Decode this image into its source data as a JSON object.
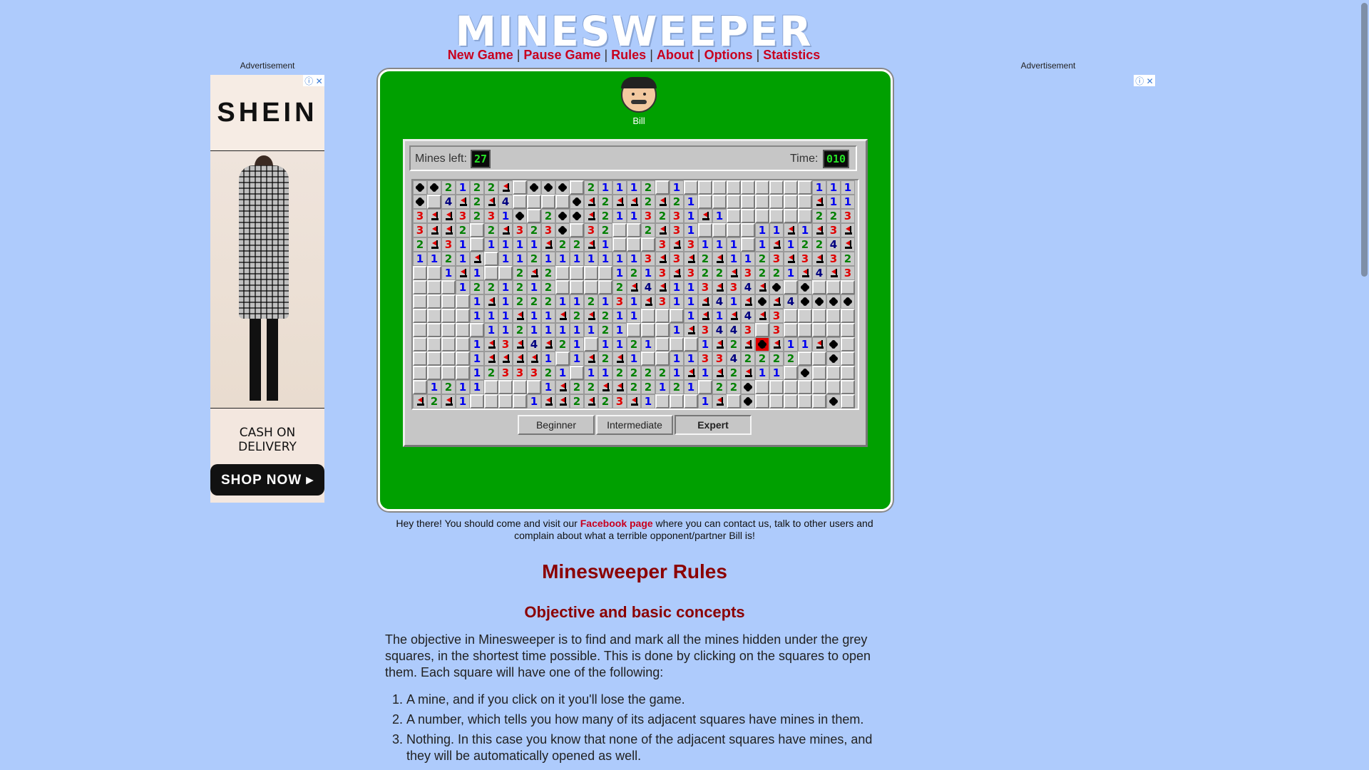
{
  "header": {
    "logo": "MINESWEEPER",
    "nav": [
      "New Game",
      "Pause Game",
      "Rules",
      "About",
      "Options",
      "Statistics"
    ]
  },
  "ads": {
    "left_label": "Advertisement",
    "right_label": "Advertisement",
    "left": {
      "brand": "SHEIN",
      "tagline": "CASH ON DELIVERY",
      "cta": "SHOP NOW ▸"
    }
  },
  "game": {
    "opponent": "Bill",
    "mines_left_label": "Mines left:",
    "mines_left": "27",
    "time_label": "Time:",
    "time": "010",
    "levels": [
      "Beginner",
      "Intermediate",
      "Expert"
    ],
    "active_level": "Expert",
    "board": [
      "MM2122F.MMM.21112.1.........1111F",
      "M.4F2F4....MF2FF2F21........F111",
      "3FF3231M.2MMF2113231F1......2231",
      "3FF2.2F323M.32..2F31....11F1F3F3",
      "2F31.1111F22F1...3F3111.1F1224F1F",
      "1121F.11211111113F3F2F1123F3F322",
      "..1F1..2F2....1213F322F3221F4F31F1",
      "...1221212....2F4F113F34F*.*...*",
      "....1F1222112131F311F41F*F4****..",
      "....111F11F2F211...1F1F4F3......",
      ".....1121111121...1F3443.3......",
      "....1F3F4F21.1121...1F2F1F11F*..**",
      "....1FFFF1.1F2F1..113342222..*...",
      "....1233321.1122221F1F2F11.*....",
      ".1211....1F22FF22121.22*......",
      "F2F1....1FF2F23F1...1F.*.....*"
    ]
  },
  "notice": {
    "text_before": "Hey there! You should come and visit our ",
    "link": "Facebook page",
    "text_after": " where you can contact us, talk to other users and complain about what a terrible opponent/partner Bill is!"
  },
  "rules": {
    "title": "Minesweeper Rules",
    "subtitle": "Objective and basic concepts",
    "intro": "The objective in Minesweeper is to find and mark all the mines hidden under the grey squares, in the shortest time possible. This is done by clicking on the squares to open them. Each square will have one of the following:",
    "items": [
      "A mine, and if you click on it you'll lose the game.",
      "A number, which tells you how many of its adjacent squares have mines in them.",
      "Nothing. In this case you know that none of the adjacent squares have mines, and they will be automatically opened as well."
    ]
  }
}
